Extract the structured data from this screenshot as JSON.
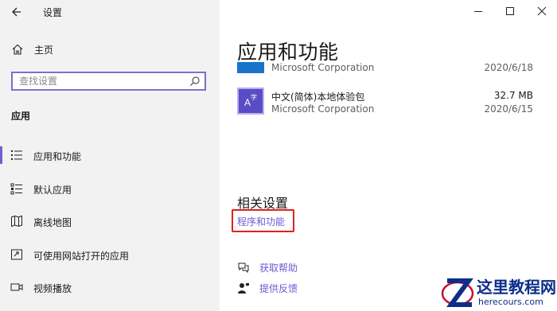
{
  "window": {
    "title": "设置",
    "controls": [
      "minimize",
      "maximize",
      "close"
    ]
  },
  "sidebar": {
    "home_label": "主页",
    "search": {
      "placeholder": "查找设置",
      "value": ""
    },
    "section_label": "应用",
    "items": [
      {
        "label": "应用和功能",
        "icon": "apps-list-icon",
        "active": true
      },
      {
        "label": "默认应用",
        "icon": "default-apps-icon",
        "active": false
      },
      {
        "label": "离线地图",
        "icon": "offline-maps-icon",
        "active": false
      },
      {
        "label": "可使用网站打开的应用",
        "icon": "apps-for-websites-icon",
        "active": false
      },
      {
        "label": "视频播放",
        "icon": "video-playback-icon",
        "active": false
      }
    ]
  },
  "main": {
    "title": "应用和功能",
    "apps": [
      {
        "name": "",
        "publisher": "Microsoft Corporation",
        "size": "",
        "date": "2020/6/18",
        "icon": "app-tile-icon"
      },
      {
        "name": "中文(简体)本地体验包",
        "publisher": "Microsoft Corporation",
        "size": "32.7 MB",
        "date": "2020/6/15",
        "icon": "language-pack-icon"
      }
    ],
    "related_title": "相关设置",
    "related_link": "程序和功能",
    "help_links": [
      {
        "label": "获取帮助",
        "icon": "chat-help-icon"
      },
      {
        "label": "提供反馈",
        "icon": "feedback-icon"
      }
    ]
  },
  "watermark": {
    "line1": "这里教程网",
    "line2": "herecours.com"
  },
  "colors": {
    "accent": "#6d5fd3",
    "link": "#6a5bd6",
    "highlight_box": "#e02020",
    "sidebar_bg": "#f2f2f2"
  }
}
